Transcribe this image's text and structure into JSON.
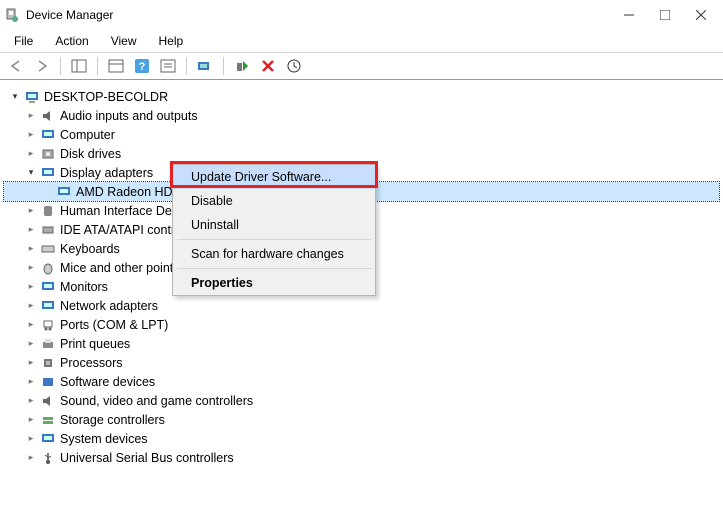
{
  "title": "Device Manager",
  "menubar": {
    "file": "File",
    "action": "Action",
    "view": "View",
    "help": "Help"
  },
  "root": "DESKTOP-BECOLDR",
  "nodes": {
    "audio": "Audio inputs and outputs",
    "computer": "Computer",
    "disk": "Disk drives",
    "display": "Display adapters",
    "amd": "AMD Radeon HD",
    "hid": "Human Interface Dev",
    "ide": "IDE ATA/ATAPI contro",
    "keyboards": "Keyboards",
    "mice": "Mice and other point",
    "monitors": "Monitors",
    "network": "Network adapters",
    "ports": "Ports (COM & LPT)",
    "printq": "Print queues",
    "processors": "Processors",
    "software": "Software devices",
    "sound": "Sound, video and game controllers",
    "storage": "Storage controllers",
    "system": "System devices",
    "usb": "Universal Serial Bus controllers"
  },
  "context": {
    "update": "Update Driver Software...",
    "disable": "Disable",
    "uninstall": "Uninstall",
    "scan": "Scan for hardware changes",
    "properties": "Properties"
  }
}
